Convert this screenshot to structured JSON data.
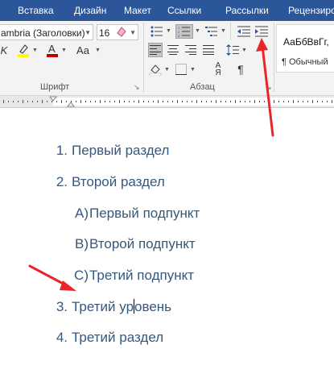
{
  "ribbon_tabs": [
    "Вставка",
    "Дизайн",
    "Макет",
    "Ссылки",
    "Рассылки",
    "Рецензиро"
  ],
  "font": {
    "name": "ambria (Заголовки)",
    "size": "16",
    "group_label": "Шрифт"
  },
  "paragraph": {
    "group_label": "Абзац"
  },
  "styles": {
    "preview": "АаБбВвГг,",
    "name": "¶ Обычный"
  },
  "document": {
    "lines": [
      {
        "num": "1.",
        "text": "Первый раздел"
      },
      {
        "num": "2.",
        "text": "Второй раздел"
      },
      {
        "num": "A)",
        "text": "Первый подпункт"
      },
      {
        "num": "B)",
        "text": "Второй подпункт"
      },
      {
        "num": "C)",
        "text": "Третий подпункт"
      },
      {
        "num": "3.",
        "text_before_cursor": "Третий ур",
        "text_after_cursor": "овень"
      },
      {
        "num": "4.",
        "text": "Третий раздел"
      }
    ]
  },
  "colors": {
    "ribbon_tabbar": "#2b579a",
    "list_text": "#34587f",
    "annotation_arrow": "#e8262a",
    "font_color_swatch": "#c00000",
    "highlight_swatch": "#ffff00"
  },
  "icons": {
    "bullets": "bullets-list-icon",
    "numbering": "numbering-list-icon",
    "multilevel": "multilevel-list-icon",
    "decrease_indent": "decrease-indent-icon",
    "increase_indent": "increase-indent-icon",
    "clear_format": "clear-formatting-icon",
    "show_marks": "pilcrow-icon"
  }
}
